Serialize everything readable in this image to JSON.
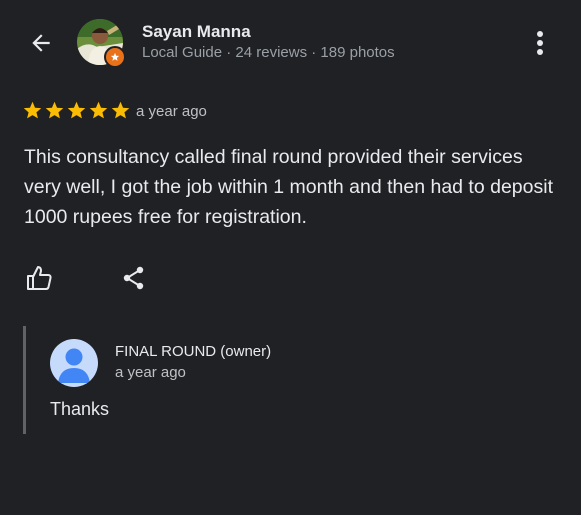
{
  "header": {
    "back_icon": "arrow-left-icon",
    "more_icon": "more-vert-icon"
  },
  "author": {
    "name": "Sayan Manna",
    "meta": "Local Guide · 24 reviews · 189 photos",
    "badge_icon": "local-guide-star-icon"
  },
  "review": {
    "rating": 5,
    "rating_max": 5,
    "star_color": "#fbbc04",
    "time": "a year ago",
    "text": "This consultancy called final round provided their services very well, I got the job within 1 month and then had to deposit 1000 rupees free for registration."
  },
  "actions": {
    "like_icon": "thumbs-up-icon",
    "share_icon": "share-icon"
  },
  "owner_response": {
    "name": "FINAL ROUND (owner)",
    "time": "a year ago",
    "text": "Thanks",
    "avatar_icon": "default-avatar-icon",
    "avatar_color": "#4285f4"
  }
}
